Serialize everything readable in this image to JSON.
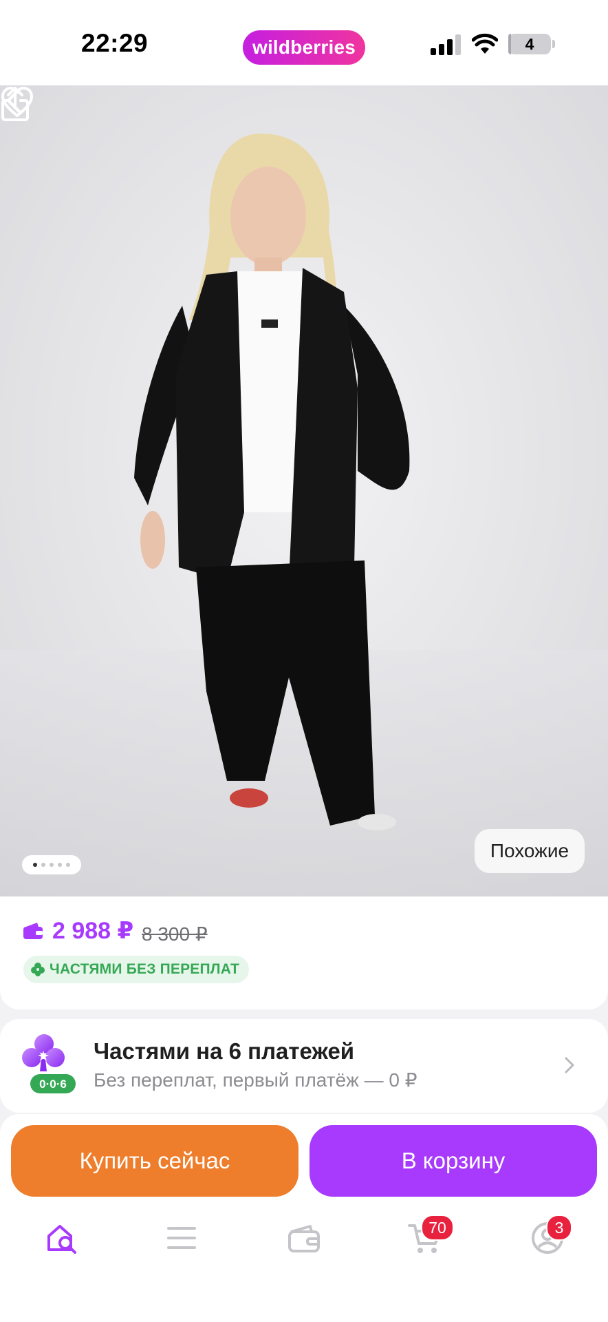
{
  "status_bar": {
    "time": "22:29",
    "brand": "wildberries",
    "battery": "4",
    "battery_level": 0.04
  },
  "product": {
    "gallery": {
      "total_images": 5,
      "current_index": 1,
      "similar_label": "Похожие"
    },
    "price": "2 988 ₽",
    "old_price": "8 300 ₽",
    "installment_badge": "ЧАСТЯМИ БЕЗ ПЕРЕПЛАТ"
  },
  "installment_plan": {
    "title": "Частями на 6 платежей",
    "subtitle": "Без переплат, первый платёж — 0 ₽",
    "icon_label": "0·0·6"
  },
  "actions": {
    "buy_now": "Купить сейчас",
    "add_to_cart": "В корзину"
  },
  "tab_bar": {
    "cart_badge": "70",
    "profile_badge": "3"
  },
  "colors": {
    "accent": "#a73afd",
    "buy_now": "#ee7e2c",
    "brand_gradient_start": "#c51fe0",
    "brand_gradient_end": "#f0349f",
    "installment_green": "#35a855",
    "badge_red": "#e8213f"
  }
}
